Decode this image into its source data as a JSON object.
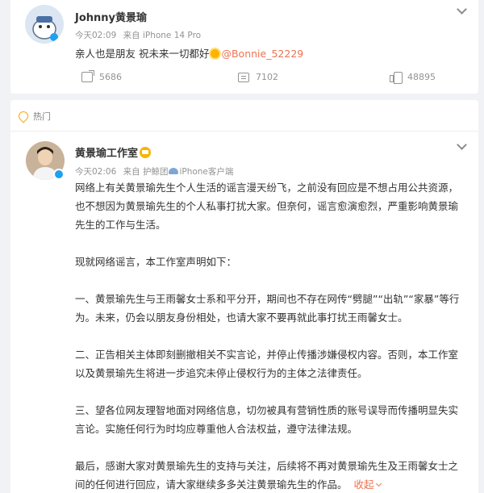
{
  "post1": {
    "name": "Johnny黄景瑜",
    "time": "今天02:09",
    "source": "来自 iPhone 14 Pro",
    "text": "亲人也是朋友 祝未来一切都好",
    "mention": "@Bonnie_52229",
    "forward_count": "5686",
    "comment_count": "7102",
    "like_count": "48895"
  },
  "hot_label": "热门",
  "post2": {
    "name": "黄景瑜工作室",
    "time": "今天02:06",
    "source": "来自 护鲸团",
    "source2": "iPhone客户端",
    "lines": [
      "网络上有关黄景瑜先生个人生活的谣言漫天纷飞，之前没有回应是不想占用公共资源，",
      "也不想因为黄景瑜先生的个人私事打扰大家。但奈何，谣言愈演愈烈，严重影响黄景瑜",
      "先生的工作与生活。",
      "",
      "现就网络谣言，本工作室声明如下：",
      "",
      "一、黄景瑜先生与王雨馨女士系和平分开，期间也不存在网传“劈腿”“出轨”“家暴”等行",
      "为。未来，仍会以朋友身份相处，也请大家不要再就此事打扰王雨馨女士。",
      "",
      "二、正告相关主体即刻删撤相关不实言论，并停止传播涉嫌侵权内容。否则，本工作室",
      "以及黄景瑜先生将进一步追究未停止侵权行为的主体之法律责任。",
      "",
      "三、望各位网友理智地面对网络信息，切勿被具有营销性质的账号误导而传播明显失实",
      "言论。实施任何行为时均应尊重他人合法权益，遵守法律法规。",
      "",
      "最后，感谢大家对黄景瑜先生的支持与关注，后续将不再对黄景瑜先生及王雨馨女士之",
      "间的任何进行回应，请大家继续多多关注黄景瑜先生的作品。"
    ],
    "more_label": "收起"
  },
  "colors": {
    "accent": "#eb7350",
    "hot": "#ffa500",
    "meta": "#939393"
  }
}
